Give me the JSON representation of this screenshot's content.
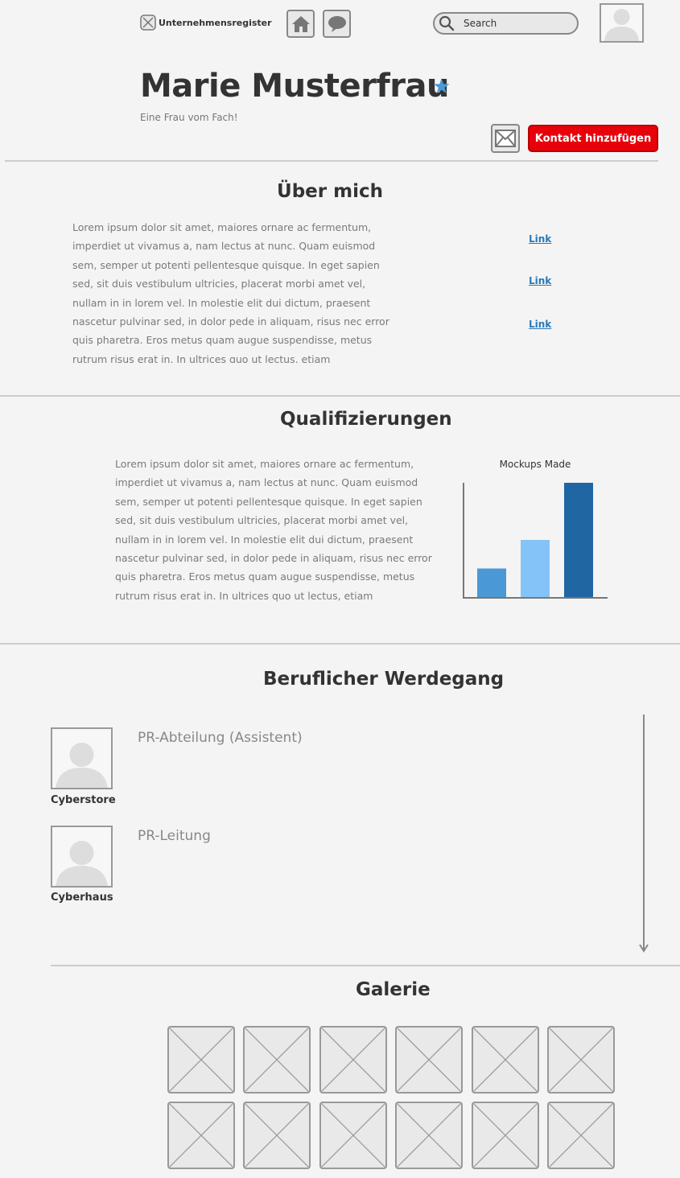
{
  "header": {
    "brand_label": "Unternehmensregister",
    "search_placeholder": "Search"
  },
  "profile": {
    "name": "Marie Musterfrau",
    "tagline": "Eine Frau vom Fach!",
    "add_contact_label": "Kontakt hinzufügen"
  },
  "about": {
    "heading": "Über mich",
    "text": "Lorem ipsum dolor sit amet, maiores ornare ac fermentum, imperdiet ut vivamus a, nam lectus at nunc. Quam euismod sem, semper ut potenti pellentesque quisque. In eget sapien sed, sit duis vestibulum ultricies, placerat morbi amet vel, nullam in in lorem vel. In molestie elit dui dictum, praesent nascetur pulvinar sed, in dolor pede in aliquam, risus nec error quis pharetra. Eros metus quam augue suspendisse, metus rutrum risus erat in.  In ultrices quo ut lectus, etiam",
    "links": [
      "Link",
      "Link",
      "Link"
    ]
  },
  "qualifications": {
    "heading": "Qualifizierungen",
    "text": "Lorem ipsum dolor sit amet, maiores ornare ac fermentum, imperdiet ut vivamus a, nam lectus at nunc. Quam euismod sem, semper ut potenti pellentesque quisque. In eget sapien sed, sit duis vestibulum ultricies, placerat morbi amet vel, nullam in in lorem vel. In molestie elit dui dictum, praesent nascetur pulvinar sed, in dolor pede in aliquam, risus nec error quis pharetra. Eros metus quam augue suspendisse, metus rutrum risus erat in.  In ultrices quo ut lectus, etiam"
  },
  "chart_data": {
    "type": "bar",
    "title": "Mockups Made",
    "categories": [
      "",
      "",
      ""
    ],
    "values": [
      25,
      50,
      100
    ],
    "colors": [
      "#4b98d6",
      "#84c3f7",
      "#1f66a3"
    ],
    "ylim": [
      0,
      100
    ],
    "grid": false
  },
  "career": {
    "heading": "Beruflicher Werdegang",
    "entries": [
      {
        "company": "Cyberstore",
        "title": "PR-Abteilung (Assistent)"
      },
      {
        "company": "Cyberhaus",
        "title": "PR-Leitung"
      }
    ]
  },
  "gallery": {
    "heading": "Galerie",
    "image_count": 12
  },
  "icons": {
    "brand": "placeholder-x-icon",
    "home": "home-icon",
    "chat": "speech-bubble-icon",
    "search": "search-icon",
    "mail": "mail-icon",
    "star": "star-icon"
  },
  "colors": {
    "accent_button": "#e8000b",
    "star": "#4a9ad8",
    "link": "#2a7ab8"
  }
}
